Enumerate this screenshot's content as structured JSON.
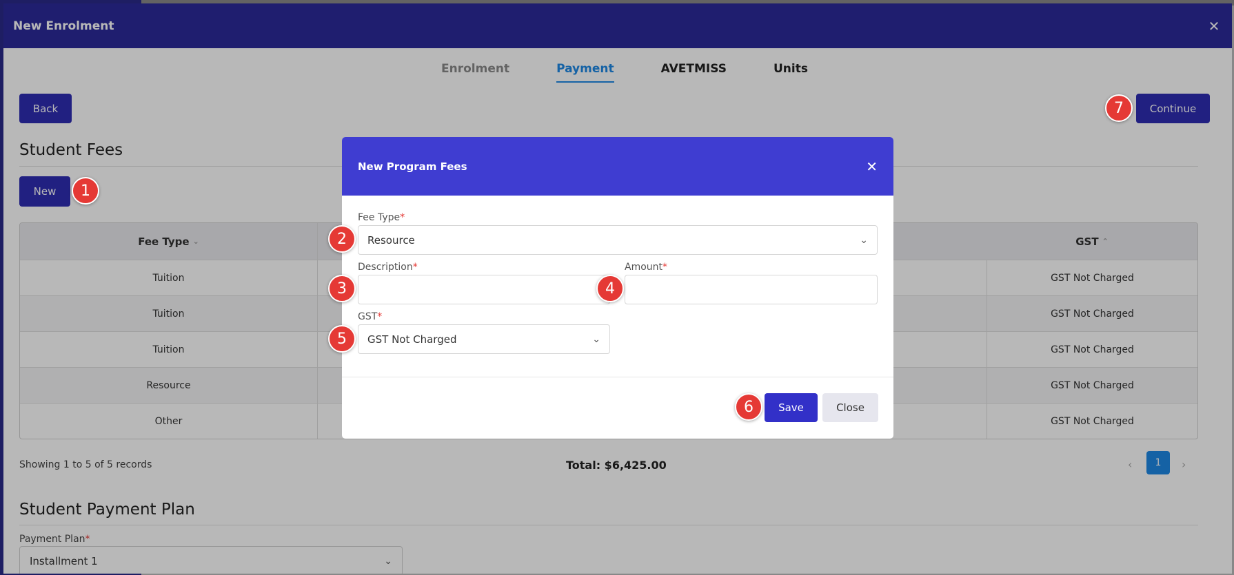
{
  "panel": {
    "title": "New Enrolment"
  },
  "tabs": [
    {
      "label": "Enrolment"
    },
    {
      "label": "Payment"
    },
    {
      "label": "AVETMISS"
    },
    {
      "label": "Units"
    }
  ],
  "actions": {
    "back": "Back",
    "continue": "Continue",
    "new": "New"
  },
  "fees": {
    "title": "Student Fees",
    "columns": {
      "fee_type": "Fee Type",
      "gst": "GST"
    },
    "rows": [
      {
        "fee_type": "Tuition",
        "gst": "GST Not Charged"
      },
      {
        "fee_type": "Tuition",
        "gst": "GST Not Charged"
      },
      {
        "fee_type": "Tuition",
        "gst": "GST Not Charged"
      },
      {
        "fee_type": "Resource",
        "gst": "GST Not Charged"
      },
      {
        "fee_type": "Other",
        "gst": "GST Not Charged"
      }
    ],
    "records": "Showing 1 to 5 of 5 records",
    "total": "Total: $6,425.00",
    "page": "1"
  },
  "payment_plan": {
    "title": "Student Payment Plan",
    "label": "Payment Plan",
    "value": "Installment 1"
  },
  "modal": {
    "title": "New Program Fees",
    "fee_type_label": "Fee Type",
    "fee_type_value": "Resource",
    "description_label": "Description",
    "description_value": "",
    "amount_label": "Amount",
    "amount_value": "",
    "gst_label": "GST",
    "gst_value": "GST Not Charged",
    "save": "Save",
    "close": "Close"
  },
  "markers": [
    "1",
    "2",
    "3",
    "4",
    "5",
    "6",
    "7"
  ],
  "icons": {
    "close": "close-icon",
    "chevron": "chevron-down-icon",
    "sort": "sort-icon"
  },
  "colors": {
    "header": "#2c2a9a",
    "modal_header": "#3f3dd1",
    "primary": "#2f2db3",
    "accent": "#1e88e5",
    "marker": "#e53935"
  }
}
